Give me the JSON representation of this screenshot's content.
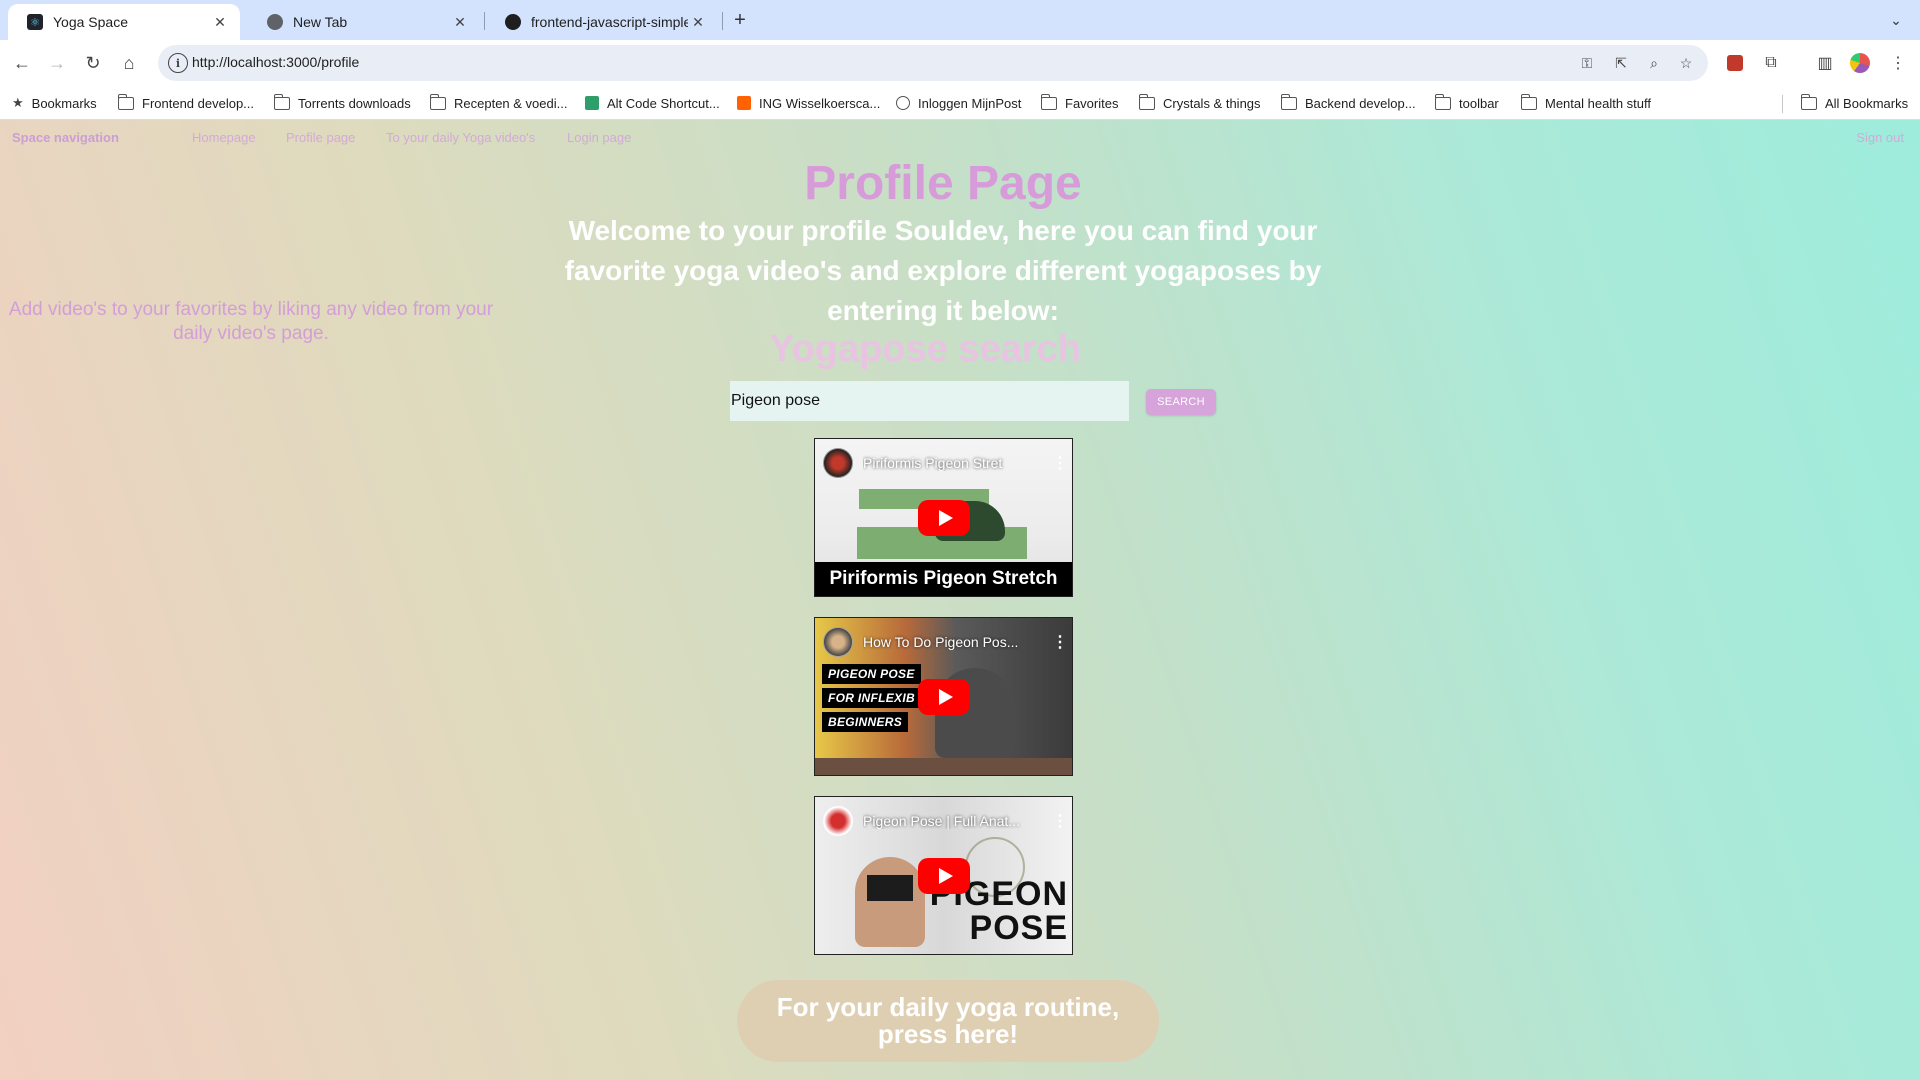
{
  "browser": {
    "tabs": [
      {
        "title": "Yoga Space",
        "active": true,
        "icon": "react-favicon-icon"
      },
      {
        "title": "New Tab",
        "active": false,
        "icon": "chrome-favicon-icon"
      },
      {
        "title": "frontend-javascript-simple-lo",
        "active": false,
        "icon": "github-favicon-icon"
      }
    ],
    "url": "http://localhost:3000/profile",
    "bookmarks": [
      {
        "label": "Bookmarks",
        "icon": "star-icon"
      },
      {
        "label": "Frontend develop...",
        "icon": "folder-icon"
      },
      {
        "label": "Torrents downloads",
        "icon": "folder-icon"
      },
      {
        "label": "Recepten & voedi...",
        "icon": "folder-icon"
      },
      {
        "label": "Alt Code Shortcut...",
        "icon": "site-favicon-icon"
      },
      {
        "label": "ING Wisselkoersca...",
        "icon": "site-favicon-icon"
      },
      {
        "label": "Inloggen MijnPost",
        "icon": "globe-icon"
      },
      {
        "label": "Favorites",
        "icon": "folder-icon"
      },
      {
        "label": "Crystals & things",
        "icon": "folder-icon"
      },
      {
        "label": "Backend develop...",
        "icon": "folder-icon"
      },
      {
        "label": "toolbar",
        "icon": "folder-icon"
      },
      {
        "label": "Mental health stuff",
        "icon": "folder-icon"
      }
    ],
    "all_bookmarks": "All Bookmarks"
  },
  "nav": {
    "brand": "Space navigation",
    "links": [
      "Homepage",
      "Profile page",
      "To your daily Yoga video's",
      "Login page"
    ],
    "signout": "Sign out"
  },
  "profile": {
    "title": "Profile Page",
    "welcome": "Welcome to your profile Souldev, here you can find your favorite yoga video's and explore different yogaposes by entering it below:",
    "favorites_note": "Add video's to your favorites by liking any video from your daily video's page."
  },
  "search": {
    "title": "Yogapose search",
    "value": "Pigeon pose",
    "button": "SEARCH"
  },
  "videos": [
    {
      "title": "Piriformis Pigeon Stret",
      "caption": "Piriformis Pigeon Stretch"
    },
    {
      "title": "How To Do Pigeon Pos...",
      "tags": [
        "PIGEON POSE",
        "FOR INFLEXIB",
        "BEGINNERS"
      ]
    },
    {
      "title": "Pigeon Pose | Full Anat...",
      "big_text": [
        "PIGEON",
        "POSE"
      ]
    }
  ],
  "routine_button": "For your daily yoga routine, press here!",
  "colors": {
    "accent_pink": "#d79bd9",
    "button_tan": "#dfcfb2",
    "youtube_red": "#ff0000"
  }
}
